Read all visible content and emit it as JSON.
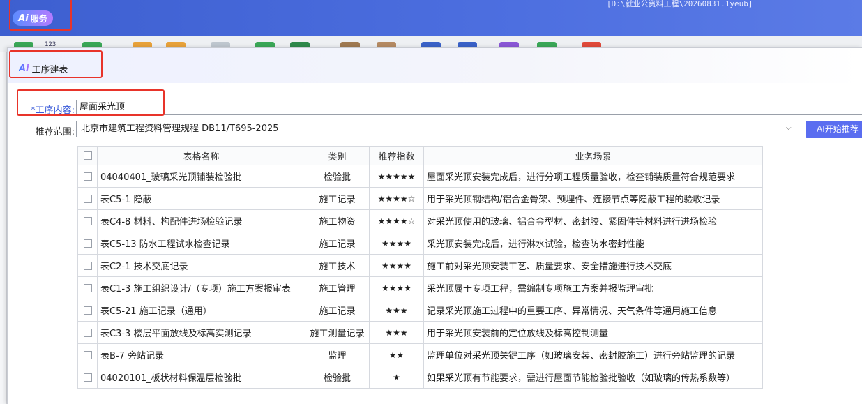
{
  "app": {
    "badge_label": "服务",
    "badge_mark": "Ai",
    "path_text": "[D:\\就业公资料工程\\20260831.1yeub]"
  },
  "toolbar": {
    "label_123": "123"
  },
  "dialog": {
    "title_mark": "Ai",
    "title": "工序建表",
    "content_label": "*工序内容:",
    "content_value": "屋面采光顶",
    "scope_label": "推荐范围:",
    "scope_value": "北京市建筑工程资料管理规程 DB11/T695-2025",
    "ai_button": "AI开始推荐"
  },
  "table": {
    "headers": [
      "表格名称",
      "类别",
      "推荐指数",
      "业务场景"
    ],
    "rows": [
      {
        "name": "04040401_玻璃采光顶铺装检验批",
        "type": "检验批",
        "stars": "★★★★★",
        "scene": "屋面采光顶安装完成后，进行分项工程质量验收，检查铺装质量符合规范要求"
      },
      {
        "name": "表C5-1 隐蔽",
        "type": "施工记录",
        "stars": "★★★★☆",
        "scene": "用于采光顶钢结构/铝合金骨架、预埋件、连接节点等隐蔽工程的验收记录"
      },
      {
        "name": "表C4-8 材料、构配件进场检验记录",
        "type": "施工物资",
        "stars": "★★★★☆",
        "scene": "对采光顶使用的玻璃、铝合金型材、密封胶、紧固件等材料进行进场检验"
      },
      {
        "name": "表C5-13 防水工程试水检查记录",
        "type": "施工记录",
        "stars": "★★★★",
        "scene": "采光顶安装完成后，进行淋水试验，检查防水密封性能"
      },
      {
        "name": "表C2-1 技术交底记录",
        "type": "施工技术",
        "stars": "★★★★",
        "scene": "施工前对采光顶安装工艺、质量要求、安全措施进行技术交底"
      },
      {
        "name": "表C1-3 施工组织设计/（专项）施工方案报审表",
        "type": "施工管理",
        "stars": "★★★★",
        "scene": "采光顶属于专项工程，需编制专项施工方案并报监理审批"
      },
      {
        "name": "表C5-21 施工记录（通用）",
        "type": "施工记录",
        "stars": "★★★",
        "scene": "记录采光顶施工过程中的重要工序、异常情况、天气条件等通用施工信息"
      },
      {
        "name": "表C3-3 楼层平面放线及标高实测记录",
        "type": "施工测量记录",
        "stars": "★★★",
        "scene": "用于采光顶安装前的定位放线及标高控制测量"
      },
      {
        "name": "表B-7 旁站记录",
        "type": "监理",
        "stars": "★★",
        "scene": "监理单位对采光顶关键工序（如玻璃安装、密封胶施工）进行旁站监理的记录"
      },
      {
        "name": "04020101_板状材料保温层检验批",
        "type": "检验批",
        "stars": "★",
        "scene": "如果采光顶有节能要求，需进行屋面节能检验批验收（如玻璃的传热系数等）"
      }
    ]
  },
  "colors": {
    "titlebar": "#4d6fe0",
    "accent_button": "#5a6df0",
    "highlight_box": "#e8342a",
    "required_label": "#3a5bd9"
  }
}
